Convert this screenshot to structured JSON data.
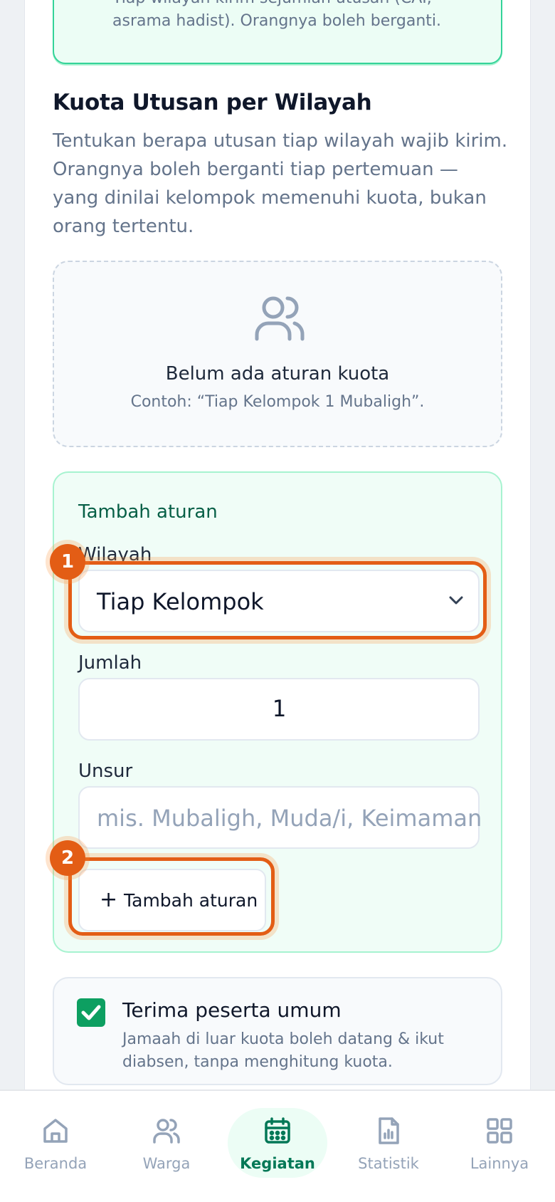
{
  "info_card": {
    "line1": "Tiap wilayah kirim sejumlah utusan (CAI,",
    "line2": "asrama hadist). Orangnya boleh berganti."
  },
  "section": {
    "title": "Kuota Utusan per Wilayah",
    "description": "Tentukan berapa utusan tiap wilayah wajib kirim. Orangnya boleh berganti tiap pertemuan — yang dinilai kelompok memenuhi kuota, bukan orang tertentu."
  },
  "empty_state": {
    "icon": "users-icon",
    "title": "Belum ada aturan kuota",
    "subtitle": "Contoh: “Tiap Kelompok 1 Mubaligh”."
  },
  "add_rule": {
    "title": "Tambah aturan",
    "wilayah_label": "Wilayah",
    "wilayah_value": "Tiap Kelompok",
    "jumlah_label": "Jumlah",
    "jumlah_value": "1",
    "unsur_label": "Unsur",
    "unsur_placeholder": "mis. Mubaligh, Muda/i, Keimaman",
    "button_plus": "+",
    "button_label": "Tambah aturan"
  },
  "annotations": {
    "badge1": "1",
    "badge2": "2"
  },
  "public_option": {
    "checked": true,
    "title": "Terima peserta umum",
    "description": "Jamaah di luar kuota boleh datang & ikut diabsen, tanpa menghitung kuota."
  },
  "nav": {
    "items": [
      {
        "label": "Beranda",
        "icon": "home-icon"
      },
      {
        "label": "Warga",
        "icon": "users-icon"
      },
      {
        "label": "Kegiatan",
        "icon": "calendar-icon",
        "active": true
      },
      {
        "label": "Statistik",
        "icon": "chart-file-icon"
      },
      {
        "label": "Lainnya",
        "icon": "grid-icon"
      }
    ]
  },
  "colors": {
    "accent": "#047857",
    "highlight": "#e35d15"
  }
}
